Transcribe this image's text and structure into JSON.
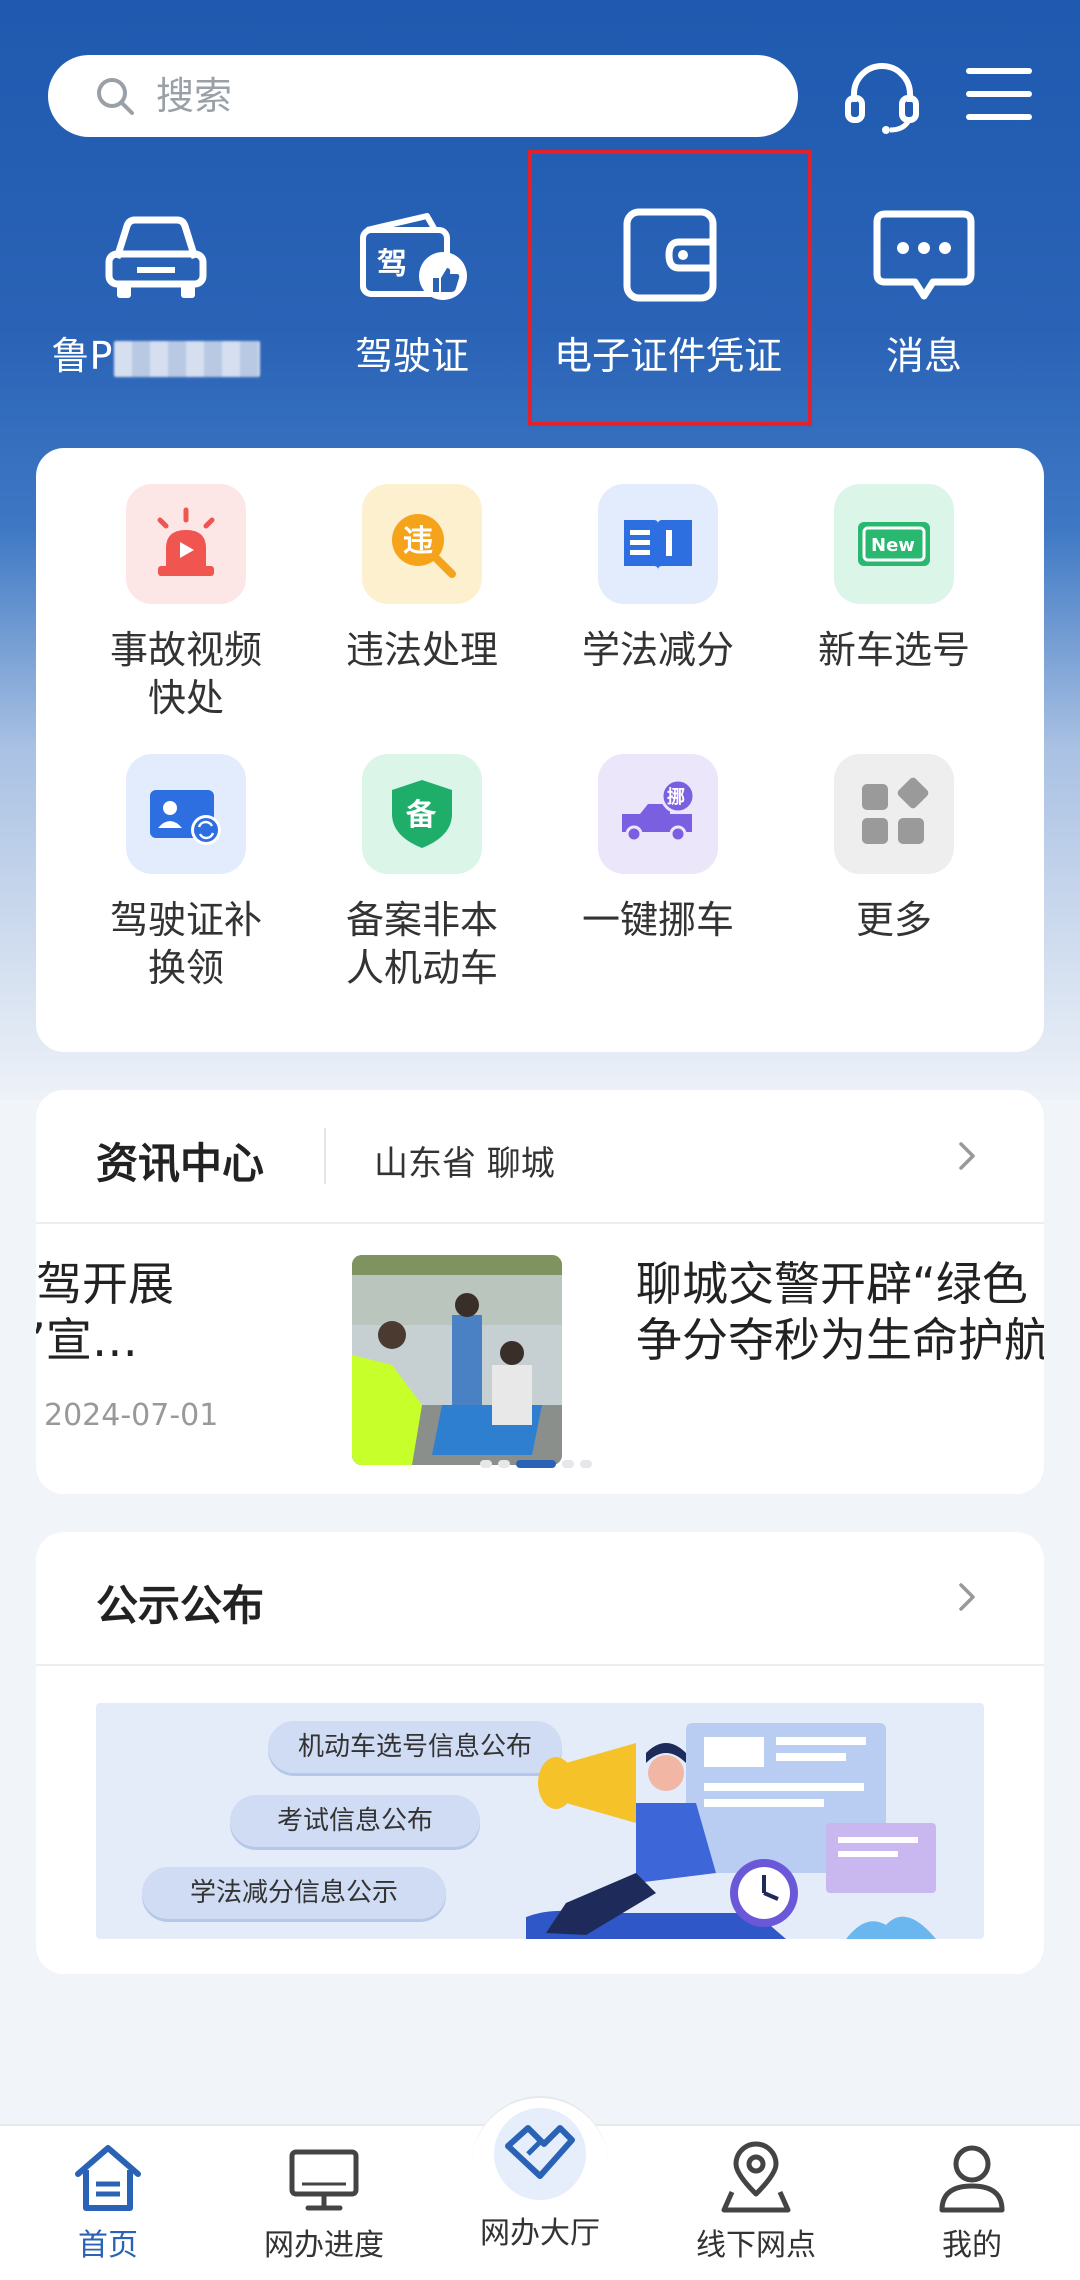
{
  "search": {
    "placeholder": "搜索"
  },
  "header": {
    "service_icon": "headset-icon",
    "menu_icon": "hamburger-menu-icon"
  },
  "quick_actions": [
    {
      "label": "鲁P",
      "icon": "car-icon"
    },
    {
      "label": "驾驶证",
      "icon": "driver-license-icon"
    },
    {
      "label": "电子证件凭证",
      "icon": "wallet-icon",
      "highlighted": true
    },
    {
      "label": "消息",
      "icon": "message-icon"
    }
  ],
  "services": [
    {
      "label": "事故视频快处",
      "icon": "siren-icon",
      "color": "#f0554f"
    },
    {
      "label": "违法处理",
      "icon": "violation-search-icon",
      "color": "#f5a31a",
      "glyph": "违"
    },
    {
      "label": "学法减分",
      "icon": "open-book-icon",
      "color": "#2d6fe0"
    },
    {
      "label": "新车选号",
      "icon": "new-plate-icon",
      "color": "#2ab870",
      "glyph": "New"
    },
    {
      "label": "驾驶证补换领",
      "icon": "license-renew-icon",
      "color": "#2d6fe0"
    },
    {
      "label": "备案非本人机动车",
      "icon": "shield-record-icon",
      "color": "#1fae6a",
      "glyph": "备"
    },
    {
      "label": "一键挪车",
      "icon": "move-truck-icon",
      "color": "#7a5fe0",
      "glyph": "挪"
    },
    {
      "label": "更多",
      "icon": "more-apps-icon",
      "color": "#9a9a9a"
    }
  ],
  "news": {
    "title": "资讯中心",
    "region": "山东省 聊城",
    "prev_line1": "驾开展",
    "prev_line2": "”宣…",
    "prev_date": "2024-07-01",
    "current_line1": "聊城交警开辟“绿色",
    "current_line2": "争分夺秒为生命护航"
  },
  "notice": {
    "title": "公示公布",
    "pills": [
      "机动车选号信息公布",
      "考试信息公布",
      "学法减分信息公示"
    ]
  },
  "bottom_nav": [
    {
      "label": "首页",
      "icon": "home-icon",
      "active": true
    },
    {
      "label": "网办进度",
      "icon": "monitor-icon",
      "active": false
    },
    {
      "label": "网办大厅",
      "icon": "handshake-icon",
      "active": false
    },
    {
      "label": "线下网点",
      "icon": "map-pin-icon",
      "active": false
    },
    {
      "label": "我的",
      "icon": "user-icon",
      "active": false
    }
  ],
  "colors": {
    "brand_blue": "#2a63b6",
    "highlight_red": "#e3212a"
  }
}
